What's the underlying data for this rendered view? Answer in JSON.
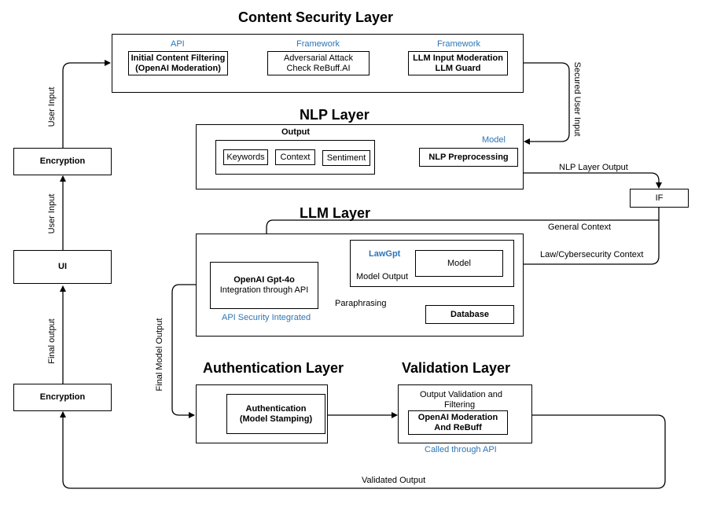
{
  "layers": {
    "content_security": "Content Security Layer",
    "nlp": "NLP Layer",
    "llm": "LLM Layer",
    "authentication": "Authentication Layer",
    "validation": "Validation Layer"
  },
  "content_security": {
    "api_label": "API",
    "framework_label_1": "Framework",
    "framework_label_2": "Framework",
    "filtering": [
      "Initial Content Filtering",
      "(OpenAI Moderation)"
    ],
    "adversarial": [
      "Adversarial Attack",
      "Check ReBuff.AI"
    ],
    "moderation": [
      "LLM Input Moderation",
      "LLM Guard"
    ]
  },
  "nlp": {
    "output_label": "Output",
    "keywords": "Keywords",
    "context": "Context",
    "sentiment": "Sentiment",
    "model_label": "Model",
    "preprocessing": "NLP Preprocessing"
  },
  "if_box": "IF",
  "llm": {
    "gpt": [
      "OpenAI Gpt-4o",
      "Integration through API"
    ],
    "api_security": "API Security Integrated",
    "lawgpt": "LawGpt",
    "model": "Model",
    "model_output": "Model Output",
    "database": "Database",
    "paraphrasing": "Paraphrasing"
  },
  "authentication": {
    "box": [
      "Authentication",
      "(Model Stamping)"
    ]
  },
  "validation": {
    "heading": [
      "Output Validation and",
      "Filtering"
    ],
    "box": [
      "OpenAI Moderation",
      "And ReBuff"
    ],
    "called": "Called through API"
  },
  "left_column": {
    "encryption_top": "Encryption",
    "ui": "UI",
    "encryption_bottom": "Encryption"
  },
  "edge_labels": {
    "user_input_top": "User Input",
    "user_input_mid": "User Input",
    "final_output": "Final output",
    "secured_user_input": "Secured User Input",
    "nlp_layer_output": "NLP Layer Output",
    "general_context": "General Context",
    "law_context": "Law/Cybersecurity Context",
    "final_model_output": "Final Model Output",
    "validated_output": "Validated Output"
  }
}
